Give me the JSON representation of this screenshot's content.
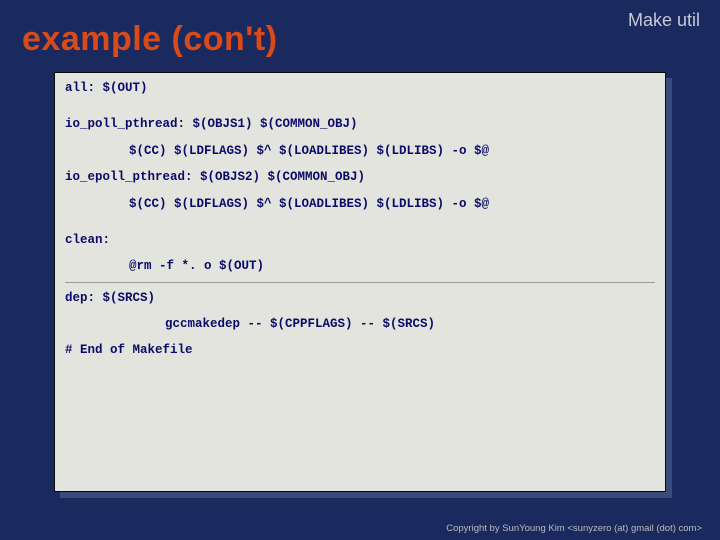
{
  "header": {
    "label": "Make util"
  },
  "title": "example (con't)",
  "code": {
    "line_all": "all: $(OUT)",
    "line_poll_target": "io_poll_pthread: $(OBJS1) $(COMMON_OBJ)",
    "line_poll_recipe": "$(CC) $(LDFLAGS) $^ $(LOADLIBES) $(LDLIBS) -o $@",
    "line_epoll_target": "io_epoll_pthread: $(OBJS2) $(COMMON_OBJ)",
    "line_epoll_recipe": "$(CC) $(LDFLAGS) $^ $(LOADLIBES) $(LDLIBS) -o $@",
    "line_clean": "clean:",
    "line_clean_recipe": "@rm -f *. o $(OUT)",
    "line_dep": "dep: $(SRCS)",
    "line_dep_recipe": "gccmakedep -- $(CPPFLAGS) -- $(SRCS)",
    "line_end": "# End of Makefile"
  },
  "footer": "Copyright by SunYoung Kim <sunyzero (at) gmail (dot) com>"
}
